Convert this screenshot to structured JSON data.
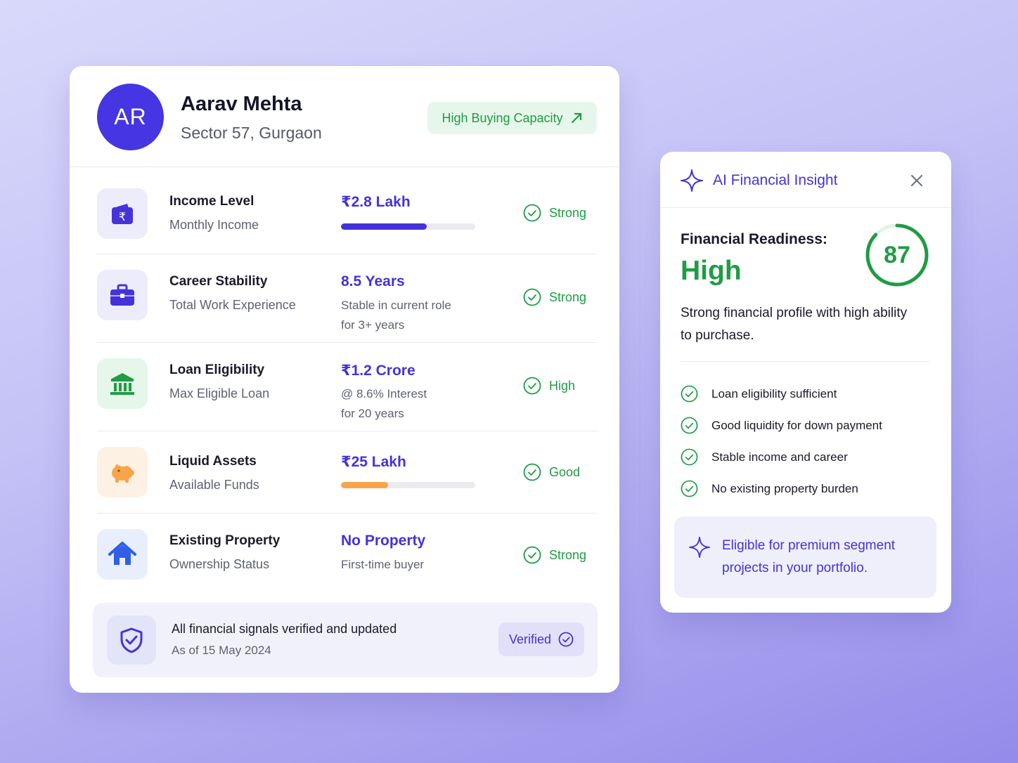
{
  "profile": {
    "avatar_initials": "AR",
    "name": "Aarav Mehta",
    "location": "Sector 57, Gurgaon",
    "capacity_badge": "High Buying Capacity"
  },
  "rows": [
    {
      "title": "Income Level",
      "subtitle": "Monthly Income",
      "value": "₹2.8 Lakh",
      "note_1": "",
      "note_2": "",
      "progress": 0.64,
      "status": "Strong",
      "icon": "wallet-rupee-icon"
    },
    {
      "title": "Career Stability",
      "subtitle": "Total Work Experience",
      "value": "8.5 Years",
      "note_1": "Stable in current role",
      "note_2": "for 3+ years",
      "status": "Strong",
      "icon": "briefcase-icon"
    },
    {
      "title": "Loan Eligibility",
      "subtitle": "Max Eligible Loan",
      "value": "₹1.2 Crore",
      "note_1": "@ 8.6% Interest",
      "note_2": "for 20 years",
      "status": "High",
      "icon": "bank-icon"
    },
    {
      "title": "Liquid Assets",
      "subtitle": "Available Funds",
      "value": "₹25 Lakh",
      "note_1": "",
      "note_2": "",
      "progress": 0.35,
      "status": "Good",
      "icon": "piggy-bank-icon"
    },
    {
      "title": "Existing Property",
      "subtitle": "Ownership Status",
      "value": "No Property",
      "note_1": "First-time buyer",
      "note_2": "",
      "status": "Strong",
      "icon": "house-icon"
    }
  ],
  "verification": {
    "title": "All financial signals verified and updated",
    "date": "As of 15 May 2024",
    "badge": "Verified"
  },
  "insight": {
    "title": "AI Financial Insight",
    "readiness_label": "Financial Readiness:",
    "readiness_level": "High",
    "score": "87",
    "score_fraction": 0.87,
    "description": "Strong financial profile with high ability to purchase.",
    "checks": [
      "Loan eligibility sufficient",
      "Good liquidity for down payment",
      "Stable income and career",
      "No existing property burden"
    ],
    "premium_note": "Eligible for premium segment projects in your portfolio."
  },
  "colors": {
    "accent": "#4433d8",
    "success": "#1f9c45",
    "orange": "#f7a44a"
  }
}
